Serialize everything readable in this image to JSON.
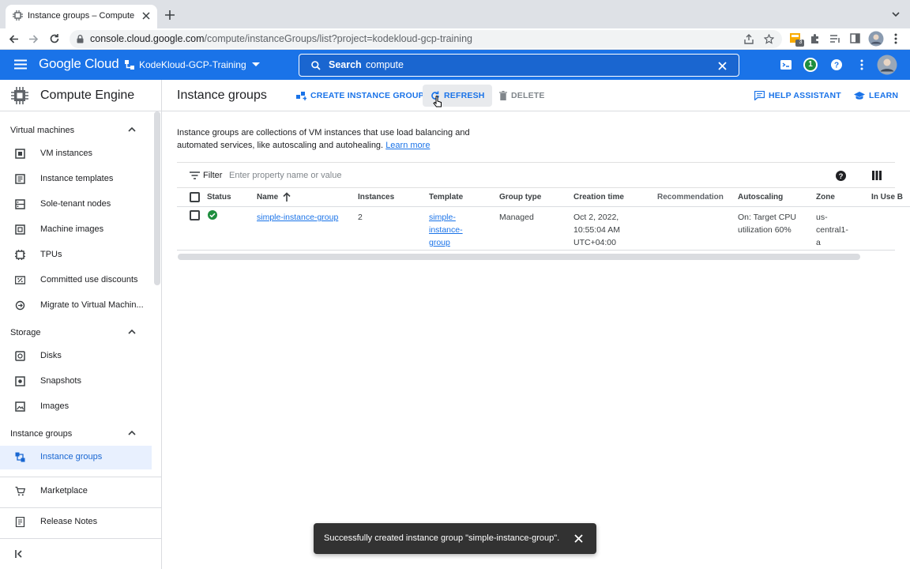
{
  "browser": {
    "tab_title": "Instance groups – Compute Engine",
    "url_host": "console.cloud.google.com",
    "url_path": "/compute/instanceGroups/list?project=kodekloud-gcp-training",
    "extension_badge": "3"
  },
  "header": {
    "logo": "Google Cloud",
    "project": "KodeKloud-GCP-Training",
    "search_label": "Search",
    "search_value": "compute",
    "notification_count": "1"
  },
  "sidebar": {
    "title": "Compute Engine",
    "sections": [
      {
        "label": "Virtual machines",
        "items": [
          {
            "label": "VM instances",
            "icon": "vm-icon"
          },
          {
            "label": "Instance templates",
            "icon": "template-icon"
          },
          {
            "label": "Sole-tenant nodes",
            "icon": "node-icon"
          },
          {
            "label": "Machine images",
            "icon": "machine-image-icon"
          },
          {
            "label": "TPUs",
            "icon": "tpu-icon"
          },
          {
            "label": "Committed use discounts",
            "icon": "percent-icon"
          },
          {
            "label": "Migrate to Virtual Machin...",
            "icon": "migrate-icon"
          }
        ]
      },
      {
        "label": "Storage",
        "items": [
          {
            "label": "Disks",
            "icon": "disk-icon"
          },
          {
            "label": "Snapshots",
            "icon": "snapshot-icon"
          },
          {
            "label": "Images",
            "icon": "image-icon"
          }
        ]
      },
      {
        "label": "Instance groups",
        "items": [
          {
            "label": "Instance groups",
            "icon": "instance-group-icon"
          }
        ]
      }
    ],
    "marketplace": "Marketplace",
    "release_notes": "Release Notes"
  },
  "page": {
    "title": "Instance groups",
    "actions": {
      "create": "CREATE INSTANCE GROUP",
      "refresh": "REFRESH",
      "delete": "DELETE",
      "help": "HELP ASSISTANT",
      "learn": "LEARN"
    },
    "intro": "Instance groups are collections of VM instances that use load balancing and automated services, like autoscaling and autohealing.",
    "learn_more": "Learn more"
  },
  "filter": {
    "label": "Filter",
    "placeholder": "Enter property name or value"
  },
  "table": {
    "columns": [
      "Status",
      "Name",
      "Instances",
      "Template",
      "Group type",
      "Creation time",
      "Recommendation",
      "Autoscaling",
      "Zone",
      "In Use B"
    ],
    "rows": [
      {
        "status": "ok",
        "name": "simple-instance-group",
        "instances": "2",
        "template_lines": [
          "simple-",
          "instance-",
          "group"
        ],
        "group_type": "Managed",
        "creation_lines": [
          "Oct 2, 2022,",
          "10:55:04 AM",
          "UTC+04:00"
        ],
        "recommendation": "",
        "autoscaling_lines": [
          "On: Target CPU",
          "utilization 60%"
        ],
        "zone_lines": [
          "us-",
          "central1-",
          "a"
        ]
      }
    ]
  },
  "toast": {
    "message": "Successfully created instance group \"simple-instance-group\"."
  },
  "colors": {
    "brand_blue": "#1a73e8",
    "status_green": "#1e8e3e",
    "toast_bg": "#323232"
  }
}
